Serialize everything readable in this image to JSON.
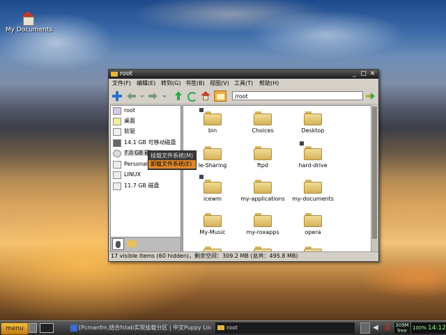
{
  "desktop": {
    "icon_label": "My Documents"
  },
  "window": {
    "title": "root",
    "menu": [
      "文件(F)",
      "编辑(E)",
      "转到(G)",
      "书签(B)",
      "视图(V)",
      "工具(T)",
      "帮助(H)"
    ],
    "address": "/root",
    "sidebar": [
      {
        "label": "root",
        "icon": "home-icon"
      },
      {
        "label": "桌面",
        "icon": "desktop-icon"
      },
      {
        "label": "软驱",
        "icon": "floppy-icon"
      },
      {
        "label": "14.1 GB 可移动磁盘",
        "icon": "usb-drive-icon"
      },
      {
        "label": "7.0 GB 磁",
        "icon": "hard-drive-icon"
      },
      {
        "label": "Personal",
        "icon": "drive-icon"
      },
      {
        "label": "LINUX",
        "icon": "drive-icon"
      },
      {
        "label": "11.7 GB 磁盘",
        "icon": "drive-icon"
      }
    ],
    "files": [
      "bin",
      "Choices",
      "Desktop",
      "le-Sharing",
      "ftpd",
      "hard-drive",
      "icewm",
      "my-applications",
      "my-documents",
      "My-Music",
      "my-roxapps",
      "opera"
    ],
    "status": "17 visible items (60 hidden)，剩余空间：309.2 MB (总共：495.8 MB)"
  },
  "context_menu": {
    "items": [
      "挂载文件系统(M)",
      "卸载文件系统(E)"
    ],
    "highlighted_index": 1
  },
  "taskbar": {
    "menu_label": "menu",
    "tasks": [
      "[Pcmanfm,结合fstab实现挂载分区 | 中文Puppy Lin",
      "root"
    ],
    "mem": "309M free",
    "battery": "100%",
    "time": "14:12",
    "colors": {
      "menu_button": "#e0a020",
      "clock_text": "#7fff7f"
    }
  }
}
